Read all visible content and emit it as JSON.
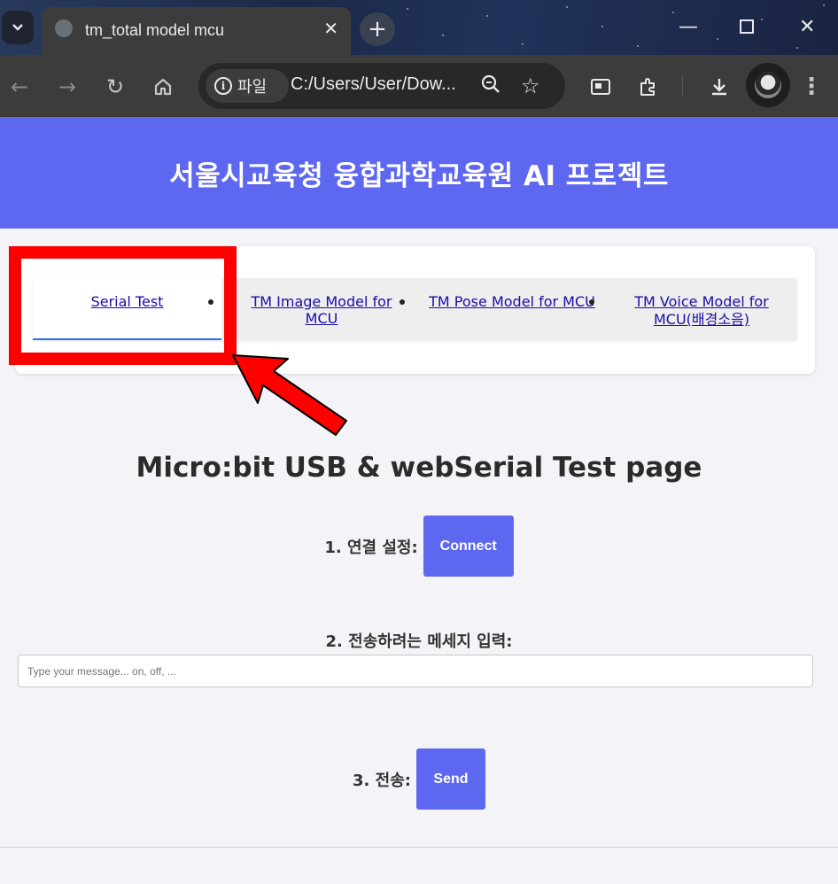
{
  "browser": {
    "tab_title": "tm_total model mcu",
    "site_label": "파일",
    "url": "C:/Users/User/Dow...",
    "new_tab": "+",
    "close_tab": "✕"
  },
  "page": {
    "header_title": "서울시교육청 융합과학교육원 AI 프로젝트",
    "nav": {
      "items": [
        {
          "label": "Serial Test",
          "active": true
        },
        {
          "label": "TM Image Model for MCU"
        },
        {
          "label": "TM Pose Model for MCU"
        },
        {
          "label": "TM Voice Model for MCU(배경소음)"
        }
      ]
    },
    "main_title": "Micro:bit USB & webSerial Test page",
    "step1_label": "1. 연결 설정:",
    "connect_button": "Connect",
    "step2_label": "2. 전송하려는 메세지 입력:",
    "message_placeholder": "Type your message... on, off, ...",
    "step3_label": "3. 전송:",
    "send_button": "Send"
  },
  "annotation": {
    "highlight_color": "#ff0000"
  },
  "colors": {
    "accent": "#5e67f0",
    "active_tab_underline": "#2f6df0"
  }
}
